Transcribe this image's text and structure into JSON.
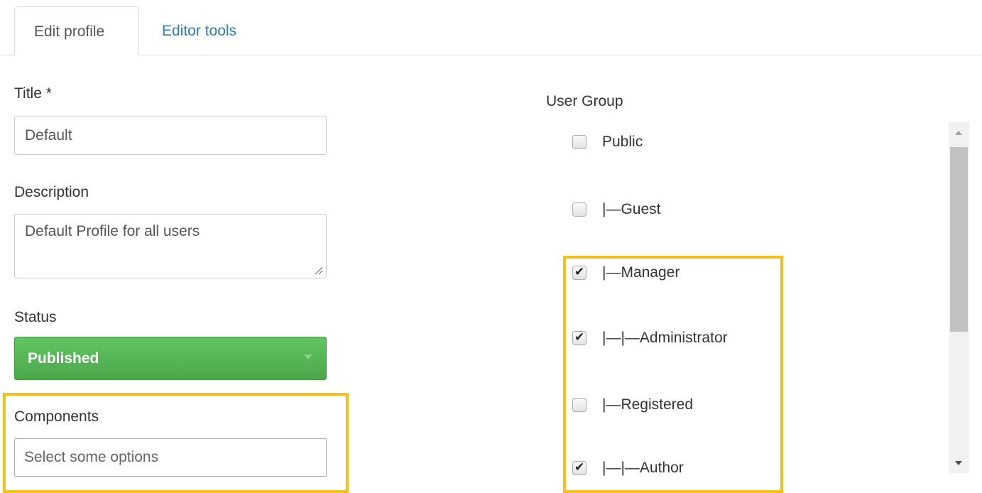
{
  "tabs": [
    {
      "label": "Edit profile",
      "active": true
    },
    {
      "label": "Editor tools",
      "active": false
    }
  ],
  "form": {
    "title_label": "Title *",
    "title_value": "Default",
    "description_label": "Description",
    "description_value": "Default Profile for all users",
    "status_label": "Status",
    "status_value": "Published",
    "components_label": "Components",
    "components_placeholder": "Select some options"
  },
  "user_group": {
    "label": "User Group",
    "items": [
      {
        "label": "Public",
        "checked": false
      },
      {
        "label": "|—Guest",
        "checked": false
      },
      {
        "label": "|—Manager",
        "checked": true
      },
      {
        "label": "|—|—Administrator",
        "checked": true
      },
      {
        "label": "|—Registered",
        "checked": false
      },
      {
        "label": "|—|—Author",
        "checked": true
      }
    ]
  },
  "colors": {
    "accent_link": "#2a7bbf",
    "status_published": "#5cb85c",
    "highlight": "#f7bf1a"
  }
}
